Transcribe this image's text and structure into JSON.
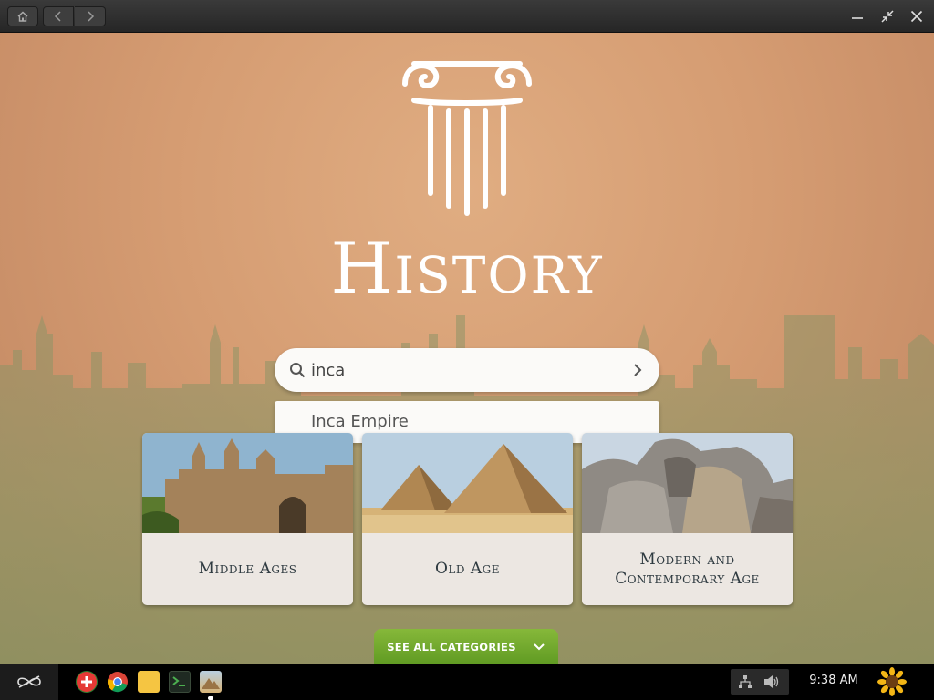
{
  "window": {
    "home_icon": "home-icon",
    "back_icon": "chevron-left-icon",
    "forward_icon": "chevron-right-icon",
    "minimize_icon": "minimize-icon",
    "restore_icon": "collapse-icon",
    "close_icon": "close-icon"
  },
  "app": {
    "title": "History",
    "logo_icon": "ionic-column-icon",
    "search": {
      "value": "inca",
      "go_icon": "chevron-right-icon"
    },
    "suggestions": [
      "Inca Empire"
    ],
    "categories": [
      {
        "label": "Middle Ages"
      },
      {
        "label": "Old Age"
      },
      {
        "label": "Modern and Contemporary Age"
      }
    ],
    "see_all_label": "SEE ALL CATEGORIES"
  },
  "taskbar": {
    "apps": [
      "app-store-icon",
      "chrome-icon",
      "files-icon",
      "terminal-icon",
      "history-app-icon"
    ],
    "clock": "9:38 AM"
  },
  "colors": {
    "accent_green": "#6aa72b",
    "background": "#d9a27a"
  }
}
